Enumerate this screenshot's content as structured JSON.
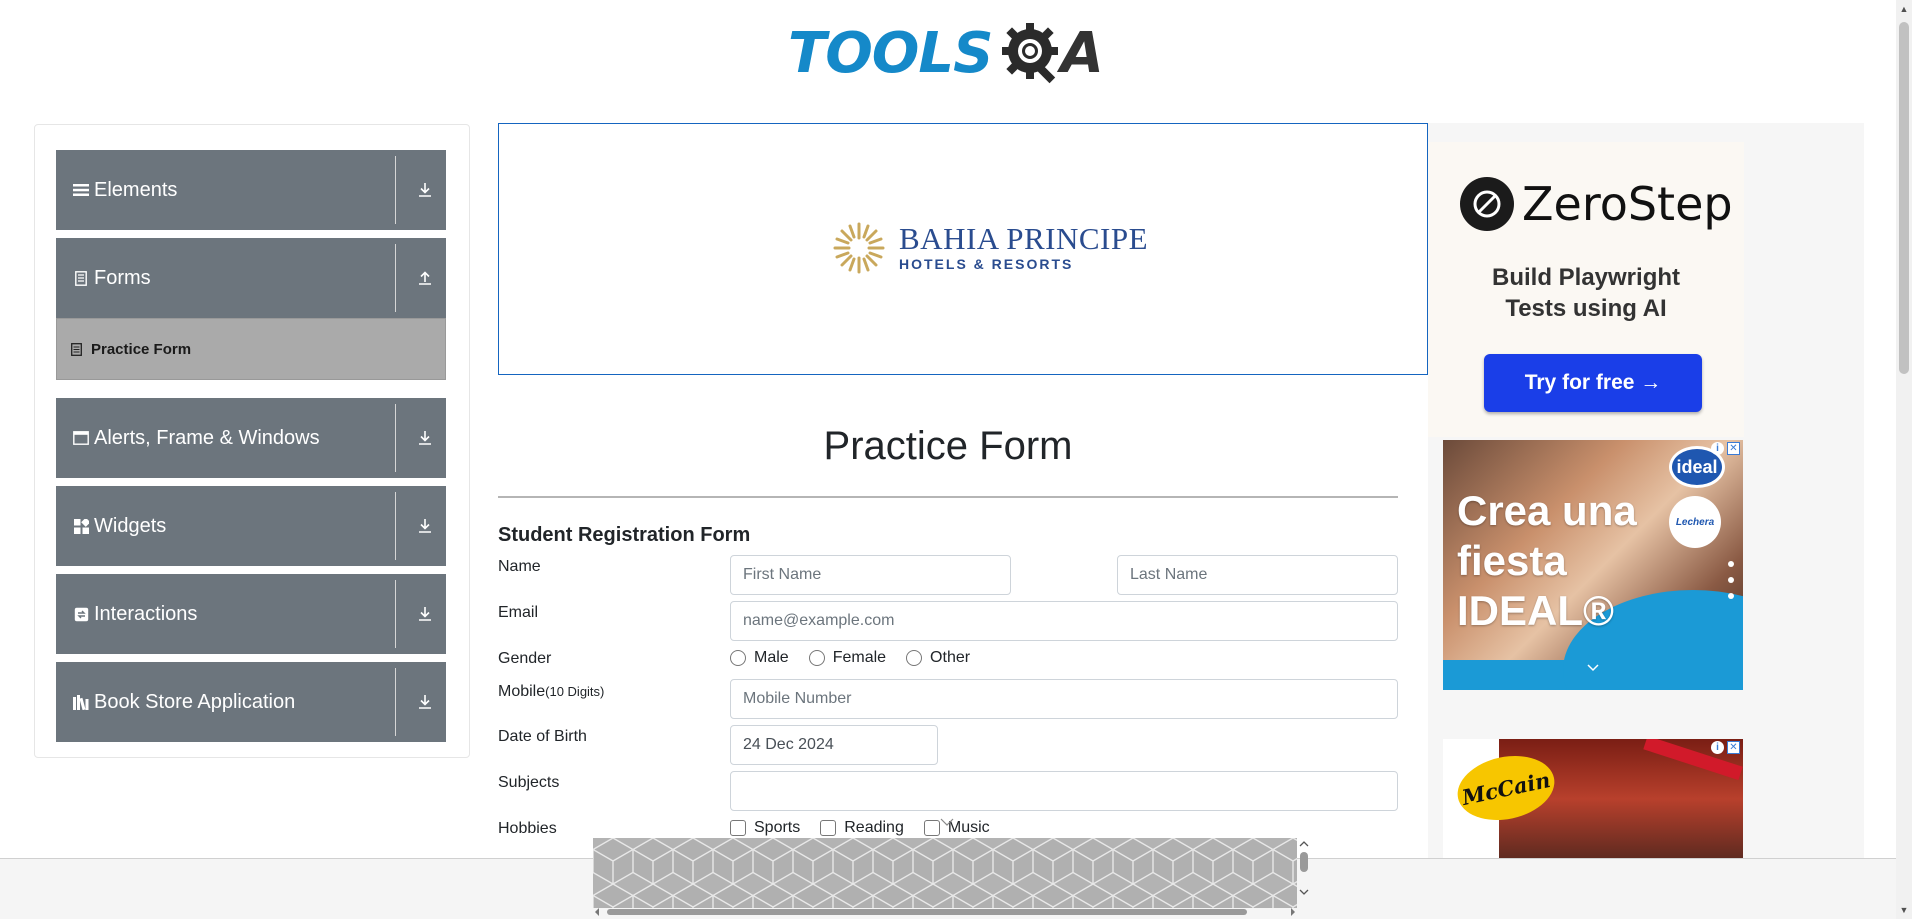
{
  "logo": {
    "part1": "TOOLS",
    "part2": "A"
  },
  "sidebar": {
    "groups": [
      {
        "label": "Elements",
        "icon": "list-icon"
      },
      {
        "label": "Forms",
        "icon": "form-icon"
      },
      {
        "label": "Alerts, Frame & Windows",
        "icon": "window-icon"
      },
      {
        "label": "Widgets",
        "icon": "widgets-icon"
      },
      {
        "label": "Interactions",
        "icon": "interactions-icon"
      },
      {
        "label": "Book Store Application",
        "icon": "books-icon"
      }
    ],
    "active_item": "Practice Form"
  },
  "banner": {
    "brand": "BAHIA PRINCIPE",
    "tagline": "HOTELS & RESORTS"
  },
  "form": {
    "title": "Practice Form",
    "subtitle": "Student Registration Form",
    "labels": {
      "name": "Name",
      "email": "Email",
      "gender": "Gender",
      "mobile": "Mobile",
      "mobile_hint": "(10 Digits)",
      "dob": "Date of Birth",
      "subjects": "Subjects",
      "hobbies": "Hobbies"
    },
    "placeholders": {
      "first_name": "First Name",
      "last_name": "Last Name",
      "email": "name@example.com",
      "mobile": "Mobile Number"
    },
    "dob_value": "24 Dec 2024",
    "gender_options": [
      "Male",
      "Female",
      "Other"
    ],
    "hobby_options": [
      "Sports",
      "Reading",
      "Music"
    ]
  },
  "ads": {
    "zerostep": {
      "name": "ZeroStep",
      "headline_line1": "Build Playwright",
      "headline_line2": "Tests using AI",
      "cta": "Try for free →"
    },
    "ideal": {
      "line1": "Crea una",
      "line2": "fiesta",
      "line3": "IDEAL®",
      "badge": "ideal",
      "badge2": "Lechera"
    },
    "mccain": {
      "brand": "McCain"
    }
  },
  "colors": {
    "sidebar_group": "#6c757d",
    "sidebar_active": "#aaaaaa",
    "logo_blue": "#1589c9",
    "cta_blue": "#1a3ee8",
    "banner_border": "#1565c0"
  }
}
